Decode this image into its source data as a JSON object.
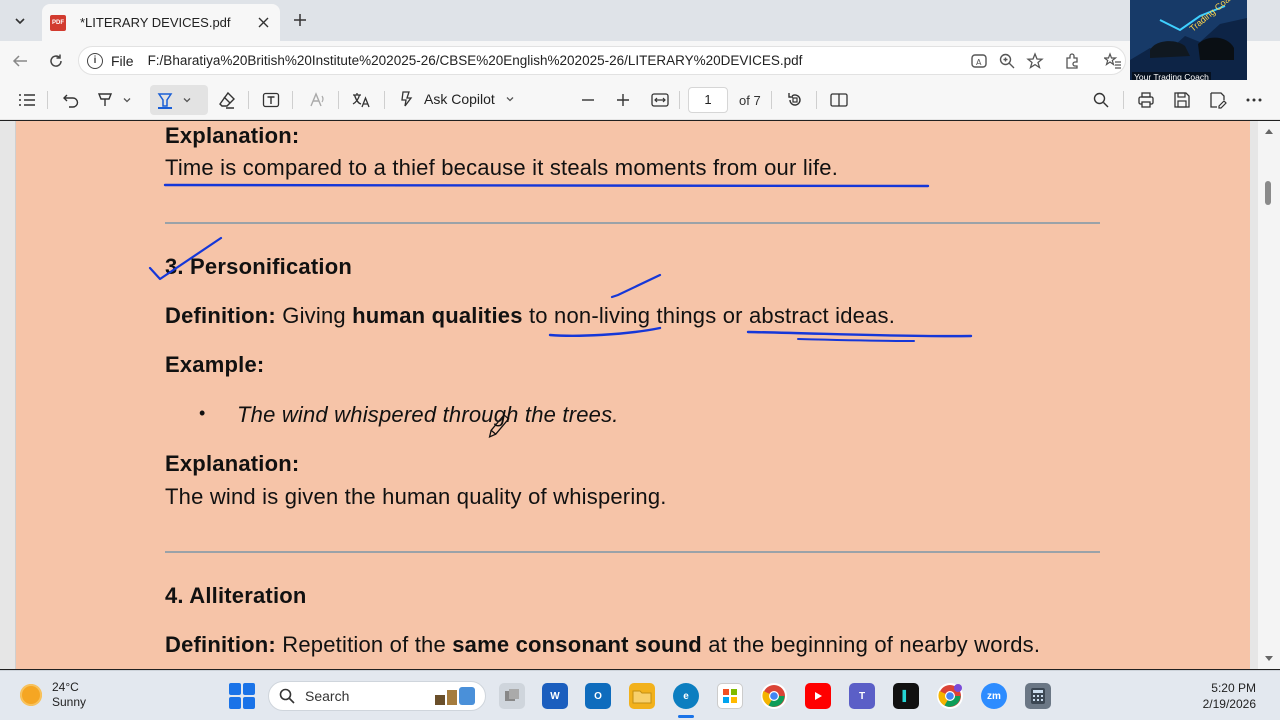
{
  "browser": {
    "tab_title": "*LITERARY DEVICES.pdf",
    "tab_icon_text": "PDF",
    "address_label": "File",
    "url": "F:/Bharatiya%20British%20Institute%202025-26/CBSE%20English%202025-26/LITERARY%20DEVICES.pdf"
  },
  "webcam": {
    "caption": "Your Trading Coach",
    "brand_text": "Trading Coach"
  },
  "pdf_toolbar": {
    "copilot_label": "Ask Copilot",
    "page_number": "1",
    "page_total": "of 7",
    "accent_color": "#1a5fd6"
  },
  "document": {
    "page_color": "#f6c4a8",
    "ink_color": "#1537d8",
    "blocks": {
      "explanation_prev_heading": "Explanation:",
      "explanation_prev_text": "Time is compared to a thief because it steals moments from our life.",
      "section3_heading": "3. Personification",
      "def_label": "Definition:",
      "def_part1": " Giving ",
      "def_bold": "human qualities",
      "def_part2": " to non-living things or abstract ideas.",
      "example_label": "Example:",
      "example_bullet": "•",
      "example_text": "The wind whispered through the trees.",
      "explanation_heading": "Explanation:",
      "explanation_text": "The wind is given the human quality of whispering.",
      "section4_heading": "4. Alliteration",
      "def4_label": "Definition:",
      "def4_part1": " Repetition of the ",
      "def4_bold": "same consonant sound",
      "def4_part2": " at the beginning of nearby words."
    }
  },
  "taskbar": {
    "temperature": "24°C",
    "weather": "Sunny",
    "search_label": "Search",
    "time": "5:20 PM",
    "date": "2/19/2026"
  }
}
